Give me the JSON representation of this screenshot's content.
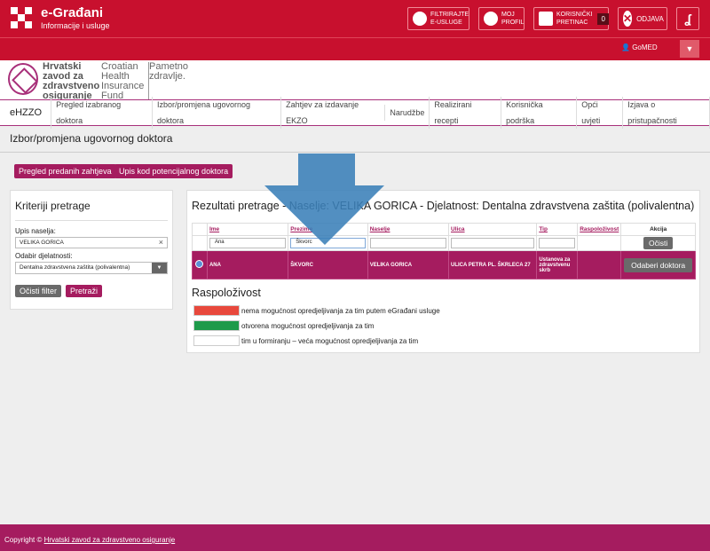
{
  "topbar": {
    "brand_title": "e-Građani",
    "brand_subtitle": "Informacije i usluge",
    "filter_label": "FILTRIRAJTE E-USLUGE",
    "profile_label": "MOJ PROFIL",
    "inbox_label": "KORISNIČKI PRETINAC",
    "inbox_count": "0",
    "logout_label": "ODJAVA"
  },
  "userbar": {
    "user": "GoMED"
  },
  "hzzo": {
    "name_hr": "Hrvatski\nzavod za\nzdravstveno\nosiguranje",
    "name_en": "Croatian\nHealth\nInsurance\nFund",
    "slogan": "Pametno\nzdravlje."
  },
  "nav": {
    "home": "eHZZO",
    "items": [
      "Pregled izabranog doktora",
      "Izbor/promjena ugovornog doktora",
      "Zahtjev za izdavanje EKZO",
      "Narudžbe",
      "Realizirani recepti",
      "Korisnička podrška",
      "Opći uvjeti",
      "Izjava o pristupačnosti"
    ]
  },
  "page_title": "Izbor/promjena ugovornog doktora",
  "actions": {
    "review": "Pregled predanih zahtjeva",
    "enroll": "Upis kod potencijalnog doktora"
  },
  "filter": {
    "title": "Kriteriji pretrage",
    "settlement_label": "Upis naselja:",
    "settlement_value": "VELIKA GORICA",
    "activity_label": "Odabir djelatnosti:",
    "activity_value": "Dentalna zdravstvena zaštita (polivalentna)",
    "clear": "Očisti filter",
    "search": "Pretraži"
  },
  "results": {
    "title": "Rezultati pretrage - Naselje: VELIKA GORICA - Djelatnost: Dentalna zdravstvena zaštita (polivalentna)",
    "headers": [
      "Ime",
      "Prezime",
      "Naselje",
      "Ulica",
      "Tip",
      "Raspoloživost",
      "Akcija"
    ],
    "filter_values": [
      "Ana",
      "Škvorc",
      "",
      "",
      ""
    ],
    "clear": "Očisti",
    "row": {
      "ime": "ANA",
      "prezime": "ŠKVORC",
      "naselje": "VELIKA GORICA",
      "ulica": "ULICA PETRA PL. ŠKRLECA 27",
      "tip": "Ustanova za zdravstvenu skrb",
      "action": "Odaberi doktora"
    }
  },
  "availability": {
    "title": "Raspoloživost",
    "items": [
      {
        "color": "#e8483c",
        "text": "nema mogućnost opredjeljivanja za tim putem eGrađani usluge"
      },
      {
        "color": "#1e9a4a",
        "text": "otvorena mogućnost opredjeljivanja za tim"
      },
      {
        "color": "#ffffff",
        "text": "tim u formiranju – veća mogućnost opredjeljivanja za tim"
      }
    ]
  },
  "footer": {
    "prefix": "Copyright ©",
    "link": "Hrvatski zavod za zdravstveno osiguranje"
  },
  "colors": {
    "brand_red": "#c8102e",
    "hzzo_magenta": "#a51c5f",
    "arrow_blue": "#3a7fb8"
  }
}
